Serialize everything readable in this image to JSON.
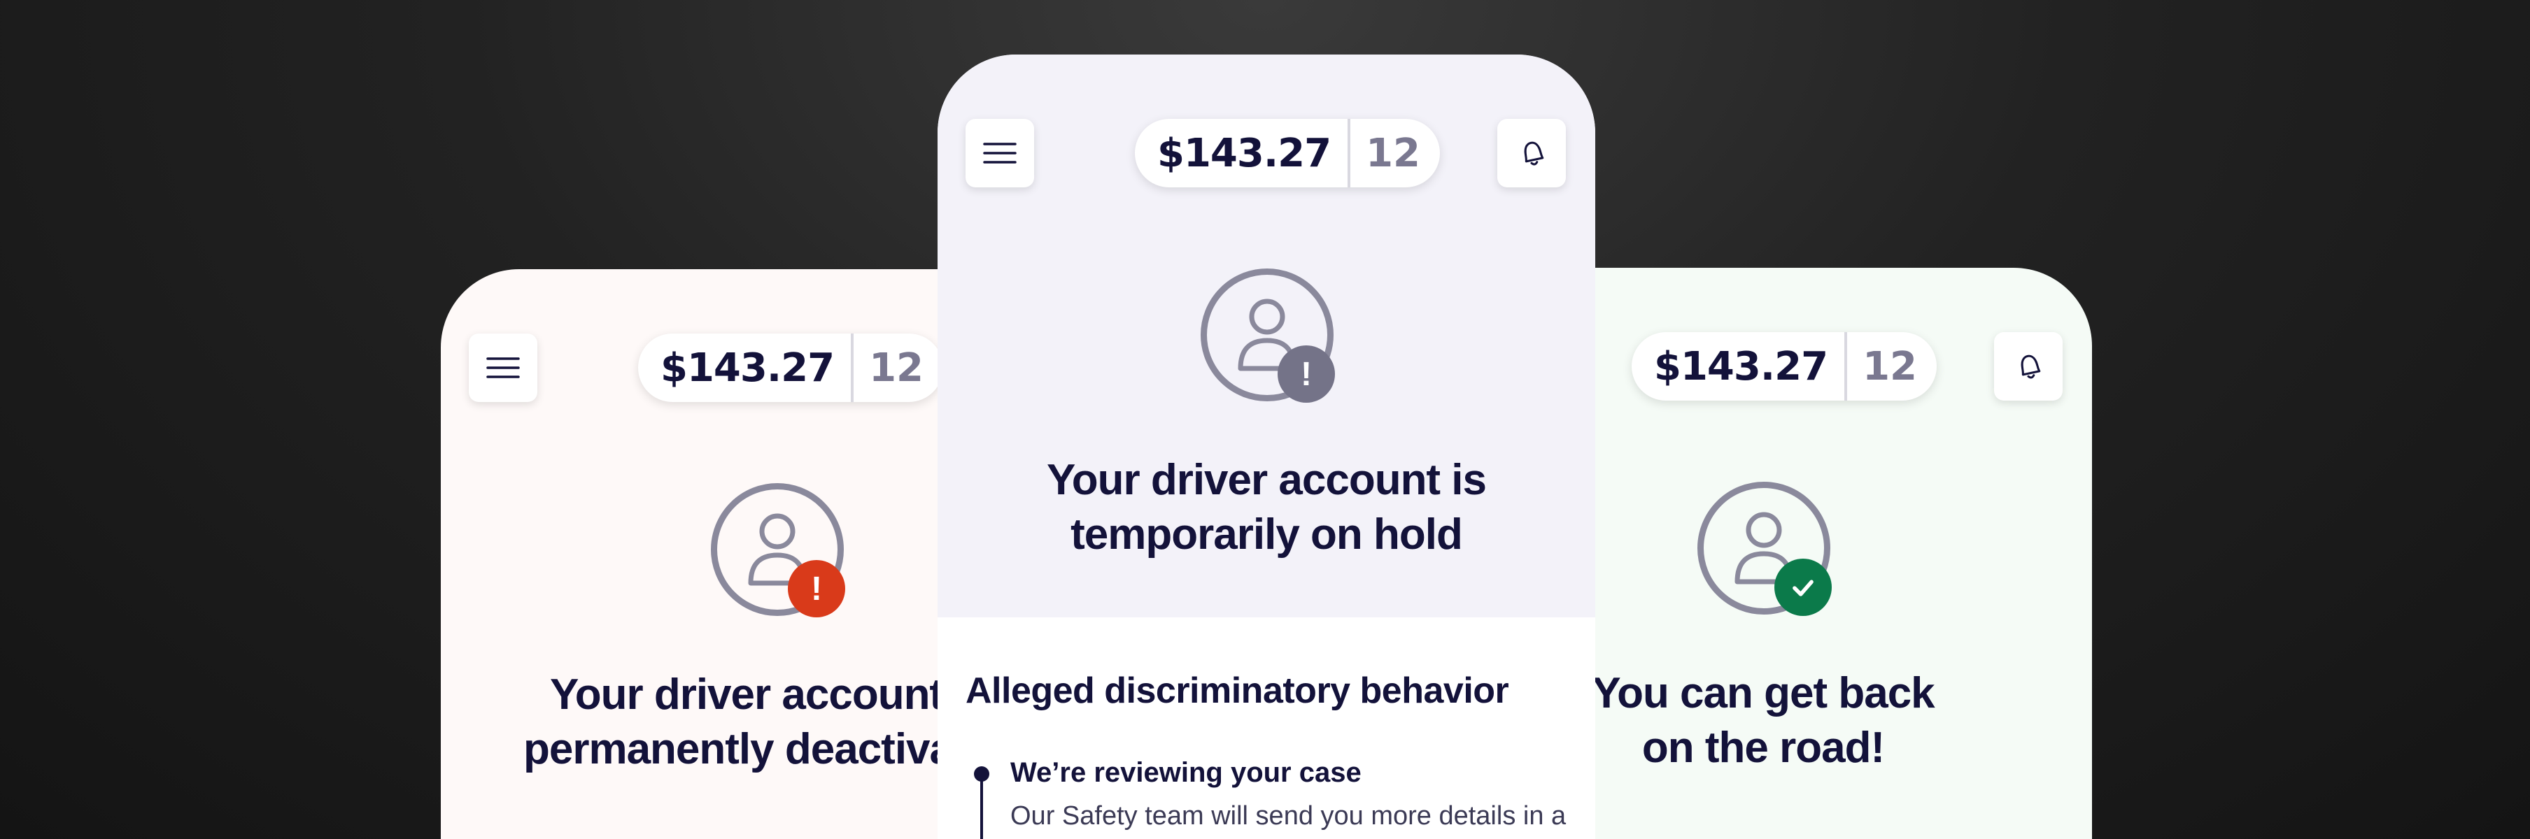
{
  "cards": {
    "left": {
      "balance": "$143.27",
      "count": "12",
      "headline_line1": "Your driver account is",
      "headline_line2": "permanently deactivated",
      "badge_symbol": "!",
      "badge_color": "#d93a1a",
      "background": "#fef9f8"
    },
    "center": {
      "balance": "$143.27",
      "count": "12",
      "headline_line1": "Your driver account is",
      "headline_line2": "temporarily on hold",
      "badge_symbol": "!",
      "badge_color": "#747388",
      "background": "#f3f2f9",
      "section_title": "Alleged discriminatory behavior",
      "timeline": {
        "title": "We’re reviewing your case",
        "body": "Our Safety team will send you more details in a"
      }
    },
    "right": {
      "balance": "$143.27",
      "count": "12",
      "headline_line1": "You can get back",
      "headline_line2": "on the road!",
      "badge_symbol": "check-icon",
      "badge_color": "#0b7a4a",
      "background": "#f5fbf6"
    }
  },
  "icons": [
    "menu-icon",
    "bell-icon",
    "user-icon",
    "alert-icon",
    "check-icon"
  ]
}
